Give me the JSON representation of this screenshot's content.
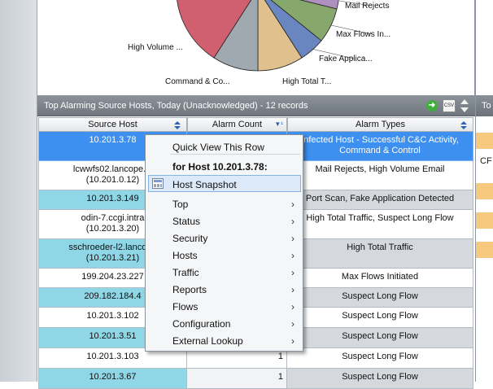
{
  "pie": {
    "labels": {
      "mail_rejects": "Mail Rejects",
      "max_flows": "Max Flows In...",
      "fake_app": "Fake Applica...",
      "high_total": "High Total T...",
      "command": "Command & Co...",
      "high_volume": "High Volume ..."
    },
    "colors": [
      "#8a7a6a",
      "#b090c0",
      "#86a86c",
      "#6a86c0",
      "#e0c08c",
      "#a0a8b0",
      "#d06070"
    ]
  },
  "panel": {
    "title": "Top Alarming Source Hosts, Today (Unacknowledged) - 12 records",
    "csv_label": "CSV"
  },
  "columns": {
    "host": "Source Host",
    "count": "Alarm Count",
    "types": "Alarm Types"
  },
  "rows": [
    {
      "host_l1": "10.201.3.78",
      "host_l2": "",
      "count": "",
      "types_l1": "Infected Host - Successful C&C Activity,",
      "types_l2": "Command & Control"
    },
    {
      "host_l1": "lcwwfs02.lancope.lc",
      "host_l2": "(10.201.0.12)",
      "count": "",
      "types_l1": "Mail Rejects, High Volume Email",
      "types_l2": ""
    },
    {
      "host_l1": "10.201.3.149",
      "host_l2": "",
      "count": "",
      "types_l1": "Port Scan, Fake Application Detected",
      "types_l2": ""
    },
    {
      "host_l1": "odin-7.ccgi.intra",
      "host_l2": "(10.201.3.20)",
      "count": "",
      "types_l1": "High Total Traffic, Suspect Long Flow",
      "types_l2": ""
    },
    {
      "host_l1": "sschroeder-l2.lancope",
      "host_l2": "(10.201.3.21)",
      "count": "",
      "types_l1": "High Total Traffic",
      "types_l2": ""
    },
    {
      "host_l1": "199.204.23.227",
      "host_l2": "",
      "count": "",
      "types_l1": "Max Flows Initiated",
      "types_l2": ""
    },
    {
      "host_l1": "209.182.184.4",
      "host_l2": "",
      "count": "",
      "types_l1": "Suspect Long Flow",
      "types_l2": ""
    },
    {
      "host_l1": "10.201.3.102",
      "host_l2": "",
      "count": "",
      "types_l1": "Suspect Long Flow",
      "types_l2": ""
    },
    {
      "host_l1": "10.201.3.51",
      "host_l2": "",
      "count": "",
      "types_l1": "Suspect Long Flow",
      "types_l2": ""
    },
    {
      "host_l1": "10.201.3.103",
      "host_l2": "",
      "count": "1",
      "types_l1": "Suspect Long Flow",
      "types_l2": ""
    },
    {
      "host_l1": "10.201.3.67",
      "host_l2": "",
      "count": "1",
      "types_l1": "Suspect Long Flow",
      "types_l2": ""
    }
  ],
  "context_menu": {
    "quick_view": "Quick View This Row",
    "for_host": "for Host 10.201.3.78:",
    "items": [
      "Host Snapshot",
      "Top",
      "Status",
      "Security",
      "Hosts",
      "Traffic",
      "Reports",
      "Flows",
      "Configuration",
      "External Lookup"
    ]
  },
  "right_panel": {
    "header": "To",
    "cell": "CF"
  }
}
